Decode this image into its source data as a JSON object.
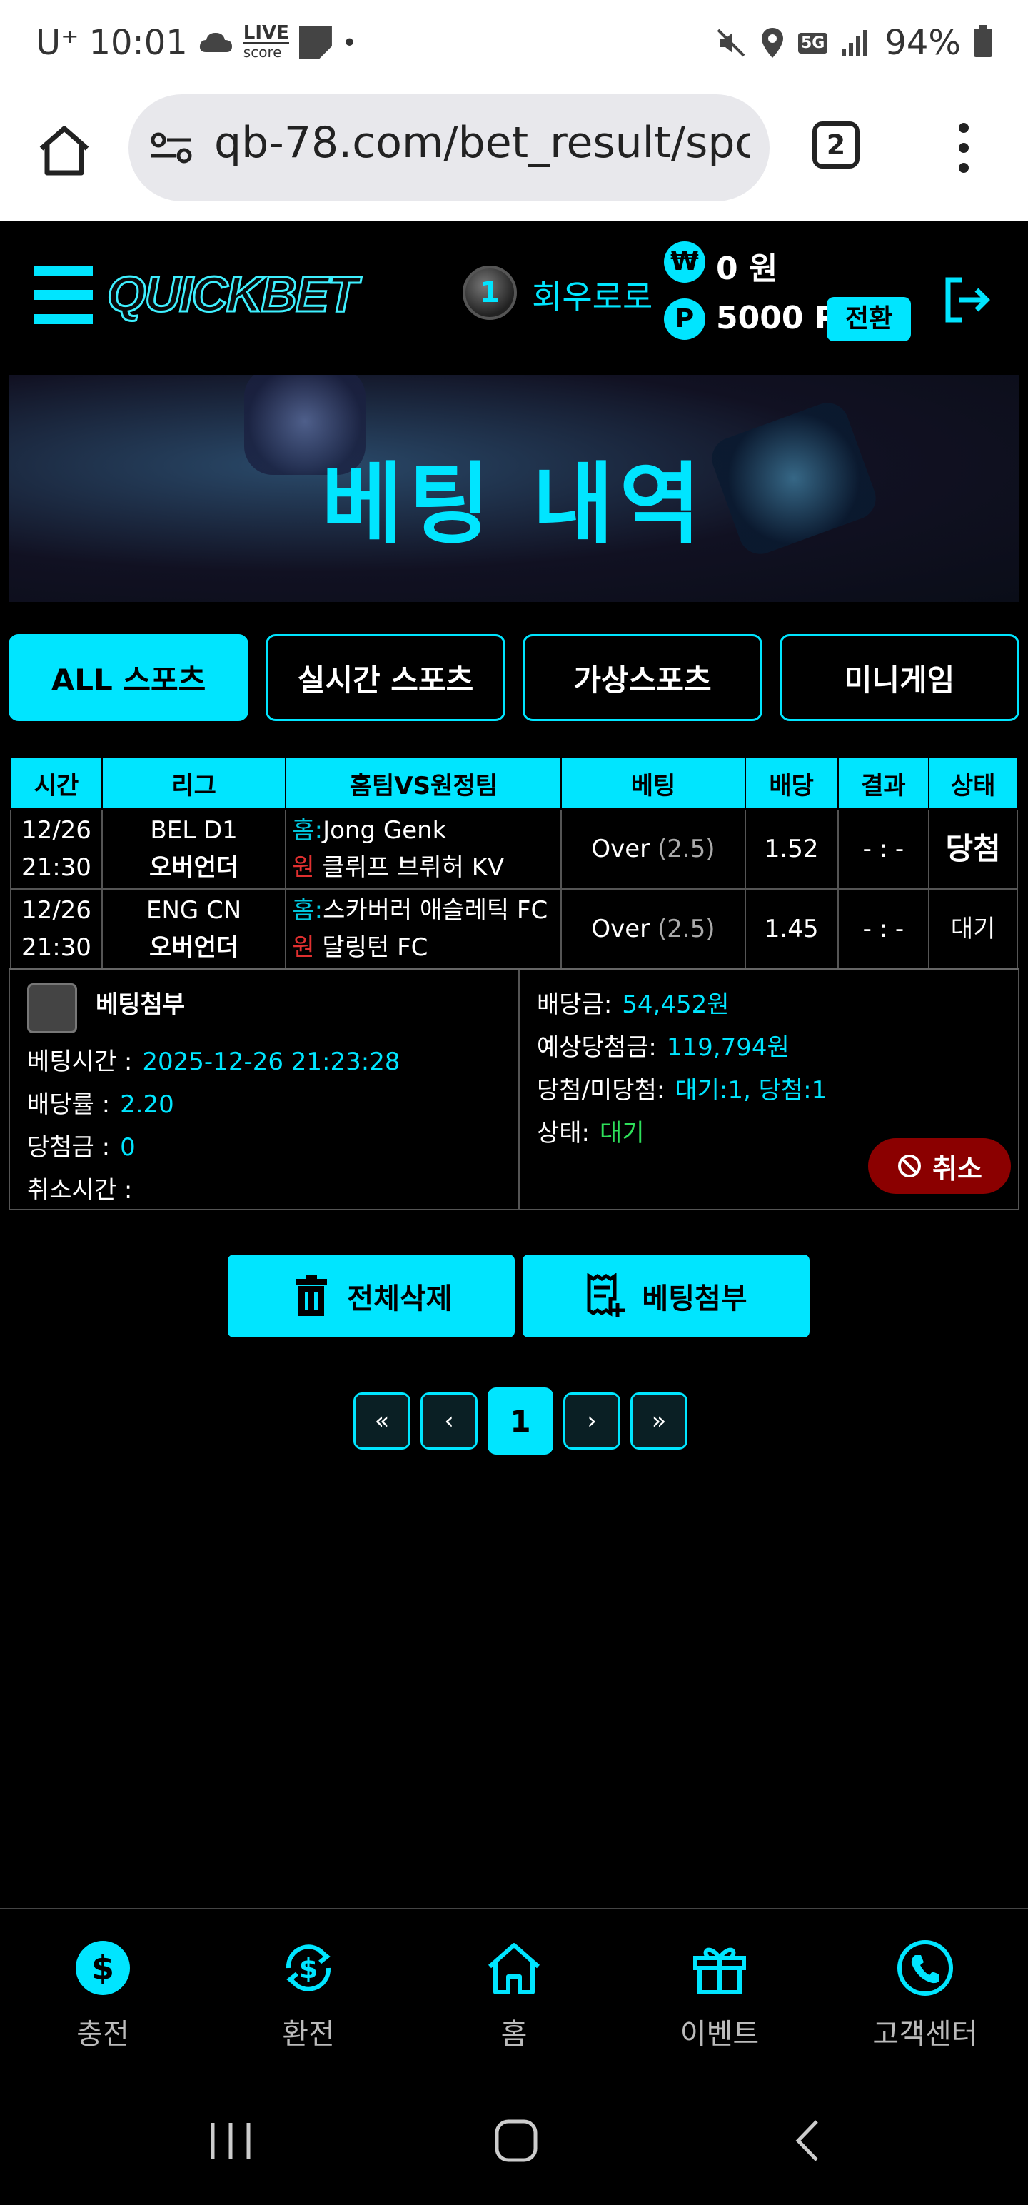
{
  "status_bar": {
    "carrier": "U⁺",
    "time": "10:01",
    "live_badge_top": "LIVE",
    "live_badge_bottom": "score",
    "dot": "•",
    "network": "5G",
    "battery": "94%"
  },
  "browser": {
    "url": "qb-78.com/bet_result/spc",
    "tab_count": "2"
  },
  "header": {
    "logo": "QUICKBET",
    "level": "1",
    "username": "회우로로",
    "won_symbol": "₩",
    "money": "0 원",
    "point_symbol": "P",
    "points": "5000 P",
    "convert_label": "전환"
  },
  "banner": {
    "title": "베팅 내역"
  },
  "tabs": [
    {
      "label": "ALL 스포츠",
      "active": true
    },
    {
      "label": "실시간 스포츠",
      "active": false
    },
    {
      "label": "가상스포츠",
      "active": false
    },
    {
      "label": "미니게임",
      "active": false
    }
  ],
  "table": {
    "headers": [
      "시간",
      "리그",
      "홈팀VS원정팀",
      "베팅",
      "배당",
      "결과",
      "상태"
    ],
    "rows": [
      {
        "date": "12/26",
        "time": "21:30",
        "league": "BEL D1",
        "market": "오버언더",
        "home_tag": "홈:",
        "home_team": "Jong Genk",
        "away_tag": "원",
        "away_team": "클뤼프 브뤼허 KV",
        "bet": "Over",
        "line": "(2.5)",
        "odds": "1.52",
        "result": "- : -",
        "status": "당첨"
      },
      {
        "date": "12/26",
        "time": "21:30",
        "league": "ENG CN",
        "market": "오버언더",
        "home_tag": "홈:",
        "home_team": "스카버러 애슬레틱 FC",
        "away_tag": "원",
        "away_team": "달링턴 FC",
        "bet": "Over",
        "line": "(2.5)",
        "odds": "1.45",
        "result": "- : -",
        "status": "대기"
      }
    ]
  },
  "summary": {
    "attach_label": "베팅첨부",
    "bet_time_label": "베팅시간 :",
    "bet_time": "2025-12-26 21:23:28",
    "odds_label": "배당률 :",
    "odds": "2.20",
    "win_amount_label": "당첨금 :",
    "win_amount": "0",
    "cancel_time_label": "취소시간 :",
    "stake_label": "배당금:",
    "stake": "54,452원",
    "expected_label": "예상당첨금:",
    "expected": "119,794원",
    "win_lose_label": "당첨/미당첨:",
    "win_lose": "대기:1, 당첨:1",
    "status_label": "상태:",
    "status": "대기",
    "cancel_label": "취소"
  },
  "actions": {
    "delete_all": "전체삭제",
    "attach": "베팅첨부"
  },
  "pagination": {
    "first": "«",
    "prev": "‹",
    "current": "1",
    "next": "›",
    "last": "»"
  },
  "bottom_nav": [
    {
      "label": "충전",
      "icon": "dollar-circle-icon"
    },
    {
      "label": "환전",
      "icon": "exchange-dollar-icon"
    },
    {
      "label": "홈",
      "icon": "home-icon"
    },
    {
      "label": "이벤트",
      "icon": "gift-icon"
    },
    {
      "label": "고객센터",
      "icon": "phone-icon"
    }
  ],
  "colors": {
    "accent": "#00e5ff",
    "background": "#000000",
    "win": "#1bb5a8",
    "wait": "#2ee05a",
    "cancel": "#8b0000"
  }
}
